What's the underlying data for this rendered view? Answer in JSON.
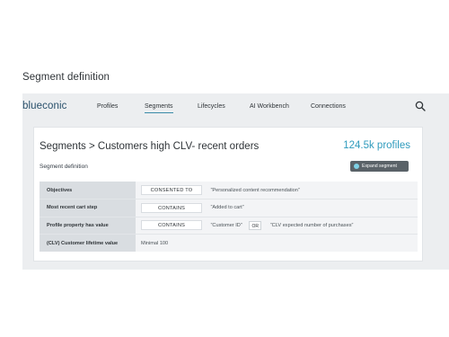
{
  "page": {
    "heading": "Segment definition"
  },
  "nav": {
    "logo": "blueconic",
    "items": [
      {
        "label": "Profiles",
        "active": false
      },
      {
        "label": "Segments",
        "active": true
      },
      {
        "label": "Lifecycles",
        "active": false
      },
      {
        "label": "AI Workbench",
        "active": false
      },
      {
        "label": "Connections",
        "active": false
      }
    ],
    "search_icon": "search-icon"
  },
  "segment": {
    "title": "Segments > Customers high CLV- recent orders",
    "profile_count": "124.5k profiles",
    "subtitle": "Segment definition",
    "expand_label": "Expand segment",
    "rules": [
      {
        "label": "Objectives",
        "operator": "CONSENTED TO",
        "value": "“Personalized content recommendation”"
      },
      {
        "label": "Most recent cart step",
        "operator": "CONTAINS",
        "value": "“Added to cart”"
      },
      {
        "label": "Profile property has value",
        "operator": "CONTAINS",
        "value": "“Customer ID”",
        "connector": "OR",
        "value2": "“CLV expected number of purchases”"
      },
      {
        "label": "(CLV) Customer lifetime value",
        "plain_value": "Minimal 100"
      }
    ]
  },
  "colors": {
    "accent": "#2f9bbd",
    "button_bg": "#5a6268",
    "logo": "#29506b",
    "frame_bg": "#eceef0"
  }
}
